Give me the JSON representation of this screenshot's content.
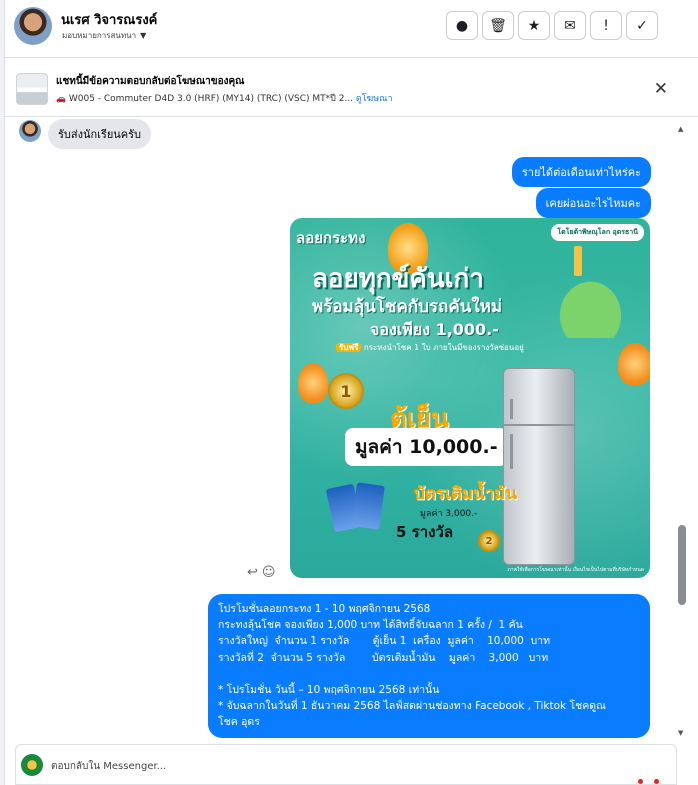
{
  "header": {
    "contact_name": "นเรศ วิจารณรงค์",
    "assign_label": "มอบหมายการสนทนา",
    "actions": [
      {
        "name": "report-button",
        "glyph": "●"
      },
      {
        "name": "delete-button",
        "glyph": "🗑"
      },
      {
        "name": "star-button",
        "glyph": "★"
      },
      {
        "name": "mark-unread-button",
        "glyph": "✉"
      },
      {
        "name": "spam-button",
        "glyph": "!"
      },
      {
        "name": "done-button",
        "glyph": "✓"
      }
    ]
  },
  "ad_banner": {
    "title": "แชทนี้มีข้อความตอบกลับต่อโฆษณาของคุณ",
    "subtitle": "W005 - Commuter D4D 3.0 (HRF) (MY14) (TRC) (VSC) MT*ปี 2...",
    "link": "ดูโฆษณา",
    "close_glyph": "✕"
  },
  "messages": {
    "incoming_1": "รับส่งนักเรียนครับ",
    "outgoing_1": "รายได้ต่อเดือนเท่าไหร่คะ",
    "outgoing_2": "เคยผ่อนอะไรไหมคะ"
  },
  "promo_image": {
    "logo": "ลอยกระทง",
    "brand": "โตโยต้าพิษณุโลก อุดรธานี",
    "headline_1": "ลอยทุกข์คันเก่า",
    "headline_2": "พร้อมลุ้นโชคกับรถคันใหม่",
    "headline_3": "จองเพียง 1,000.-",
    "note_free": "รับฟรี",
    "note": "กระทงนำโชค 1 ใบ ภายในมีของรางวัลซ่อนอยู่",
    "medal_1": "1",
    "prize_1": "ตู้เย็น",
    "value_1": "มูลค่า 10,000.-",
    "prize_2": "บัตรเติมน้ำมัน",
    "value_2": "มูลค่า 3,000.-",
    "count_2": "5 รางวัล",
    "medal_2": "2",
    "fine_print": "ภาพใช้เพื่อการโฆษณาเท่านั้น เงื่อนไขเป็นไปตามที่บริษัทกำหนด"
  },
  "message_tools": {
    "reply_glyph": "↩",
    "react_glyph": "☺"
  },
  "promo_text": {
    "lines": [
      "โปรโมชั่นลอยกระทง 1 - 10 พฤศจิกายน 2568",
      "กระทงลุ้นโชค จองเพียง 1,000 บาท ได้สิทธิ์จับฉลาก 1 ครั้ง /  1 คัน",
      "รางวัลใหญ่  จำนวน 1 รางวัล       ตู้เย็น 1  เครื่อง  มูลค่า    10,000  บาท",
      "รางวัลที่ 2  จำนวน 5 รางวัล        บัตรเติมน้ำมัน    มูลค่า    3,000   บาท",
      "",
      "* โปรโมชั่น วันนี้ – 10 พฤศจิกายน 2568 เท่านั้น",
      "* จับฉลากในวันที่ 1 ธันวาคม 2568 ไลฟ์สดผ่านช่องทาง Facebook , Tiktok โชคดูณ",
      "โชค อุดร"
    ]
  },
  "composer": {
    "placeholder": "ตอบกลับใน Messenger..."
  },
  "colors": {
    "outgoing_bubble": "#0a7cff",
    "incoming_bubble": "#e4e6eb",
    "link": "#1877f2"
  }
}
